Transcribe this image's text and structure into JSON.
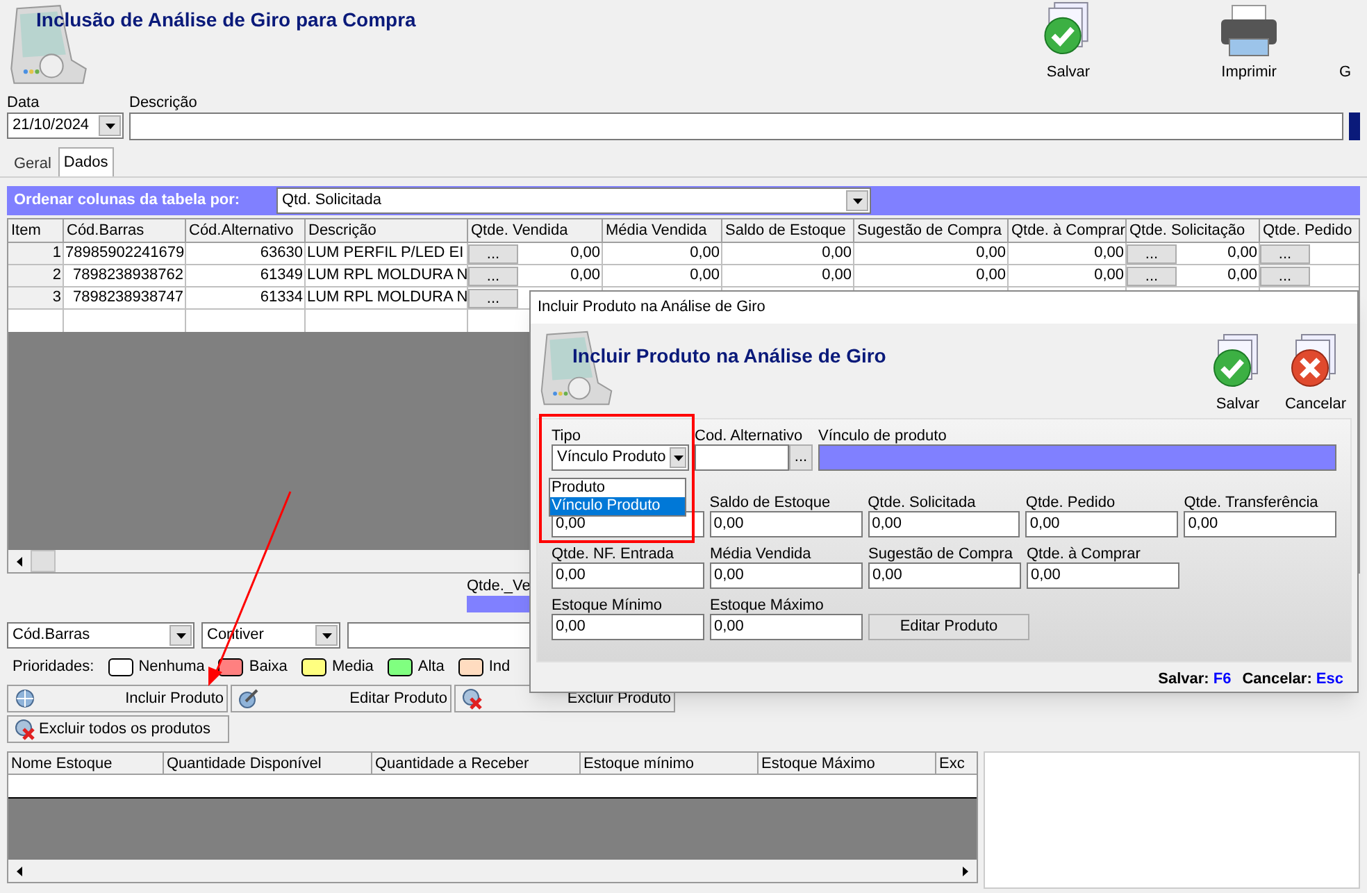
{
  "window": {
    "title": "Inclusão de Análise de Giro para Compra"
  },
  "toolbar": [
    {
      "label": "Salvar",
      "kind": "save"
    },
    {
      "label": "Imprimir",
      "kind": "print"
    },
    {
      "label": "G",
      "kind": "other"
    }
  ],
  "header_fields": {
    "date": {
      "label": "Data",
      "value": "21/10/2024"
    },
    "description": {
      "label": "Descrição"
    }
  },
  "tabs": [
    {
      "label": "Geral",
      "selected": false
    },
    {
      "label": "Dados",
      "selected": true
    }
  ],
  "sort_bar": {
    "label": "Ordenar colunas da tabela por:",
    "value": "Qtd. Solicitada"
  },
  "table": {
    "columns": [
      {
        "label": "Item"
      },
      {
        "label": "Cód.Barras"
      },
      {
        "label": "Cód.Alternativo"
      },
      {
        "label": "Descrição"
      },
      {
        "label": "Qtde. Vendida"
      },
      {
        "label": "Média Vendida"
      },
      {
        "label": "Saldo de Estoque"
      },
      {
        "label": "Sugestão de Compra"
      },
      {
        "label": "Qtde. à Comprar"
      },
      {
        "label": "Qtde. Solicitação"
      },
      {
        "label": "Qtde. Pedido"
      }
    ],
    "rows": [
      {
        "cells": [
          {
            "text": "1"
          },
          {
            "text": "78985902241679"
          },
          {
            "text": "63630"
          },
          {
            "text": "LUM PERFIL P/LED EI"
          },
          {
            "button": "...",
            "text": "0,00"
          },
          {
            "text": "0,00"
          },
          {
            "text": "0,00"
          },
          {
            "text": "0,00"
          },
          {
            "text": "0,00"
          },
          {
            "button": "...",
            "text": "0,00"
          },
          {
            "button": "..."
          }
        ]
      },
      {
        "cells": [
          {
            "text": "2"
          },
          {
            "text": "7898238938762"
          },
          {
            "text": "61349"
          },
          {
            "text": "LUM RPL MOLDURA N"
          },
          {
            "button": "...",
            "text": "0,00"
          },
          {
            "text": "0,00"
          },
          {
            "text": "0,00"
          },
          {
            "text": "0,00"
          },
          {
            "text": "0,00"
          },
          {
            "button": "...",
            "text": "0,00"
          },
          {
            "button": "..."
          }
        ]
      },
      {
        "cells": [
          {
            "text": "3"
          },
          {
            "text": "7898238938747"
          },
          {
            "text": "61334"
          },
          {
            "text": "LUM RPL MOLDURA N"
          },
          {
            "button": "..."
          }
        ]
      }
    ]
  },
  "summary": {
    "label": "Qtde._Ve"
  },
  "filter": {
    "field": "Cód.Barras",
    "mode": "Contiver"
  },
  "priorities": {
    "label": "Prioridades:",
    "items": [
      {
        "label": "Nenhuma",
        "color": "#ffffff"
      },
      {
        "label": "Baixa",
        "color": "#ff8080"
      },
      {
        "label": "Media",
        "color": "#ffff80"
      },
      {
        "label": "Alta",
        "color": "#80ff80"
      },
      {
        "label": "Ind",
        "color": "#ffdcc0"
      }
    ]
  },
  "actions": [
    {
      "label": "Incluir Produto",
      "kind": "add"
    },
    {
      "label": "Editar Produto",
      "kind": "edit"
    },
    {
      "label": "Excluir Produto",
      "kind": "delete"
    },
    {
      "label": "Excluir todos os produtos",
      "kind": "delete_all"
    }
  ],
  "stock_table": {
    "columns": [
      "Nome Estoque",
      "Quantidade Disponível",
      "Quantidade a Receber",
      "Estoque mínimo",
      "Estoque Máximo",
      "Exc"
    ]
  },
  "dialog": {
    "title": "Incluir Produto na Análise de Giro",
    "heading": "Incluir Produto na Análise de Giro",
    "buttons": [
      {
        "label": "Salvar",
        "kind": "save"
      },
      {
        "label": "Cancelar",
        "kind": "cancel"
      }
    ],
    "tipo": {
      "label": "Tipo",
      "value": "Vínculo Produto",
      "options": [
        {
          "label": "Produto",
          "selected": false
        },
        {
          "label": "Vínculo Produto",
          "selected": true
        }
      ]
    },
    "cod_alternativo": {
      "label": "Cod. Alternativo",
      "button": "..."
    },
    "vinculo": {
      "label": "Vínculo de produto"
    },
    "fields": [
      [
        {
          "value": "0,00"
        },
        {
          "label": "Saldo de Estoque",
          "value": "0,00"
        },
        {
          "label": "Qtde. Solicitada",
          "value": "0,00"
        },
        {
          "label": "Qtde. Pedido",
          "value": "0,00"
        },
        {
          "label": "Qtde. Transferência",
          "value": "0,00"
        }
      ],
      [
        {
          "label": "Qtde. NF. Entrada",
          "value": "0,00"
        },
        {
          "label": "Média Vendida",
          "value": "0,00"
        },
        {
          "label": "Sugestão de Compra",
          "value": "0,00"
        },
        {
          "label": "Qtde. à Comprar",
          "value": "0,00"
        }
      ],
      [
        {
          "label": "Estoque Mínimo",
          "value": "0,00"
        },
        {
          "label": "Estoque Máximo",
          "value": "0,00"
        }
      ]
    ],
    "edit_button": "Editar Produto",
    "shortcuts": [
      {
        "label": "Salvar:",
        "key": "F6"
      },
      {
        "label": "Cancelar:",
        "key": "Esc"
      }
    ]
  }
}
